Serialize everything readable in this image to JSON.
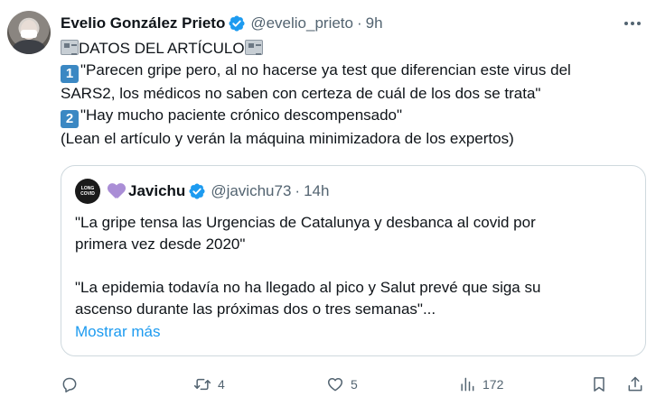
{
  "tweet": {
    "author": "Evelio González Prieto",
    "handle": "@evelio_prieto",
    "separator": "·",
    "time": "9h",
    "lines": {
      "header": "DATOS DEL ARTÍCULO",
      "keycap1": "1",
      "point1a": "\"Parecen gripe pero, al no hacerse ya test que diferencian este virus del",
      "point1b": "SARS2, los médicos no saben con certeza de cuál de los dos se trata\"",
      "keycap2": "2",
      "point2": "\"Hay mucho paciente crónico descompensado\"",
      "closing": "(Lean el artículo y verán la máquina minimizadora de los expertos)"
    }
  },
  "quote": {
    "avatar_text": [
      "LONG",
      "COVID"
    ],
    "author": "Javichu",
    "handle": "@javichu73",
    "separator": "·",
    "time": "14h",
    "line1": "\"La gripe tensa las Urgencias de Catalunya y desbanca al covid por",
    "line2": "primera vez desde 2020\"",
    "line3": "\"La epidemia todavía no ha llegado al pico y Salut prevé que siga su",
    "line4": "ascenso durante las próximas dos o tres semanas\"...",
    "show_more": "Mostrar más"
  },
  "actions": {
    "reply": {
      "icon": "reply-icon",
      "count": ""
    },
    "retweet": {
      "icon": "retweet-icon",
      "count": "4"
    },
    "like": {
      "icon": "heart-icon",
      "count": "5"
    },
    "views": {
      "icon": "views-icon",
      "count": "172"
    },
    "bookmark": {
      "icon": "bookmark-icon",
      "count": ""
    },
    "share": {
      "icon": "share-icon",
      "count": ""
    }
  },
  "colors": {
    "text": "#0f1419",
    "secondary": "#536471",
    "link": "#1d9bf0",
    "verified": "#1d9bf0",
    "border": "#cfd9de"
  }
}
